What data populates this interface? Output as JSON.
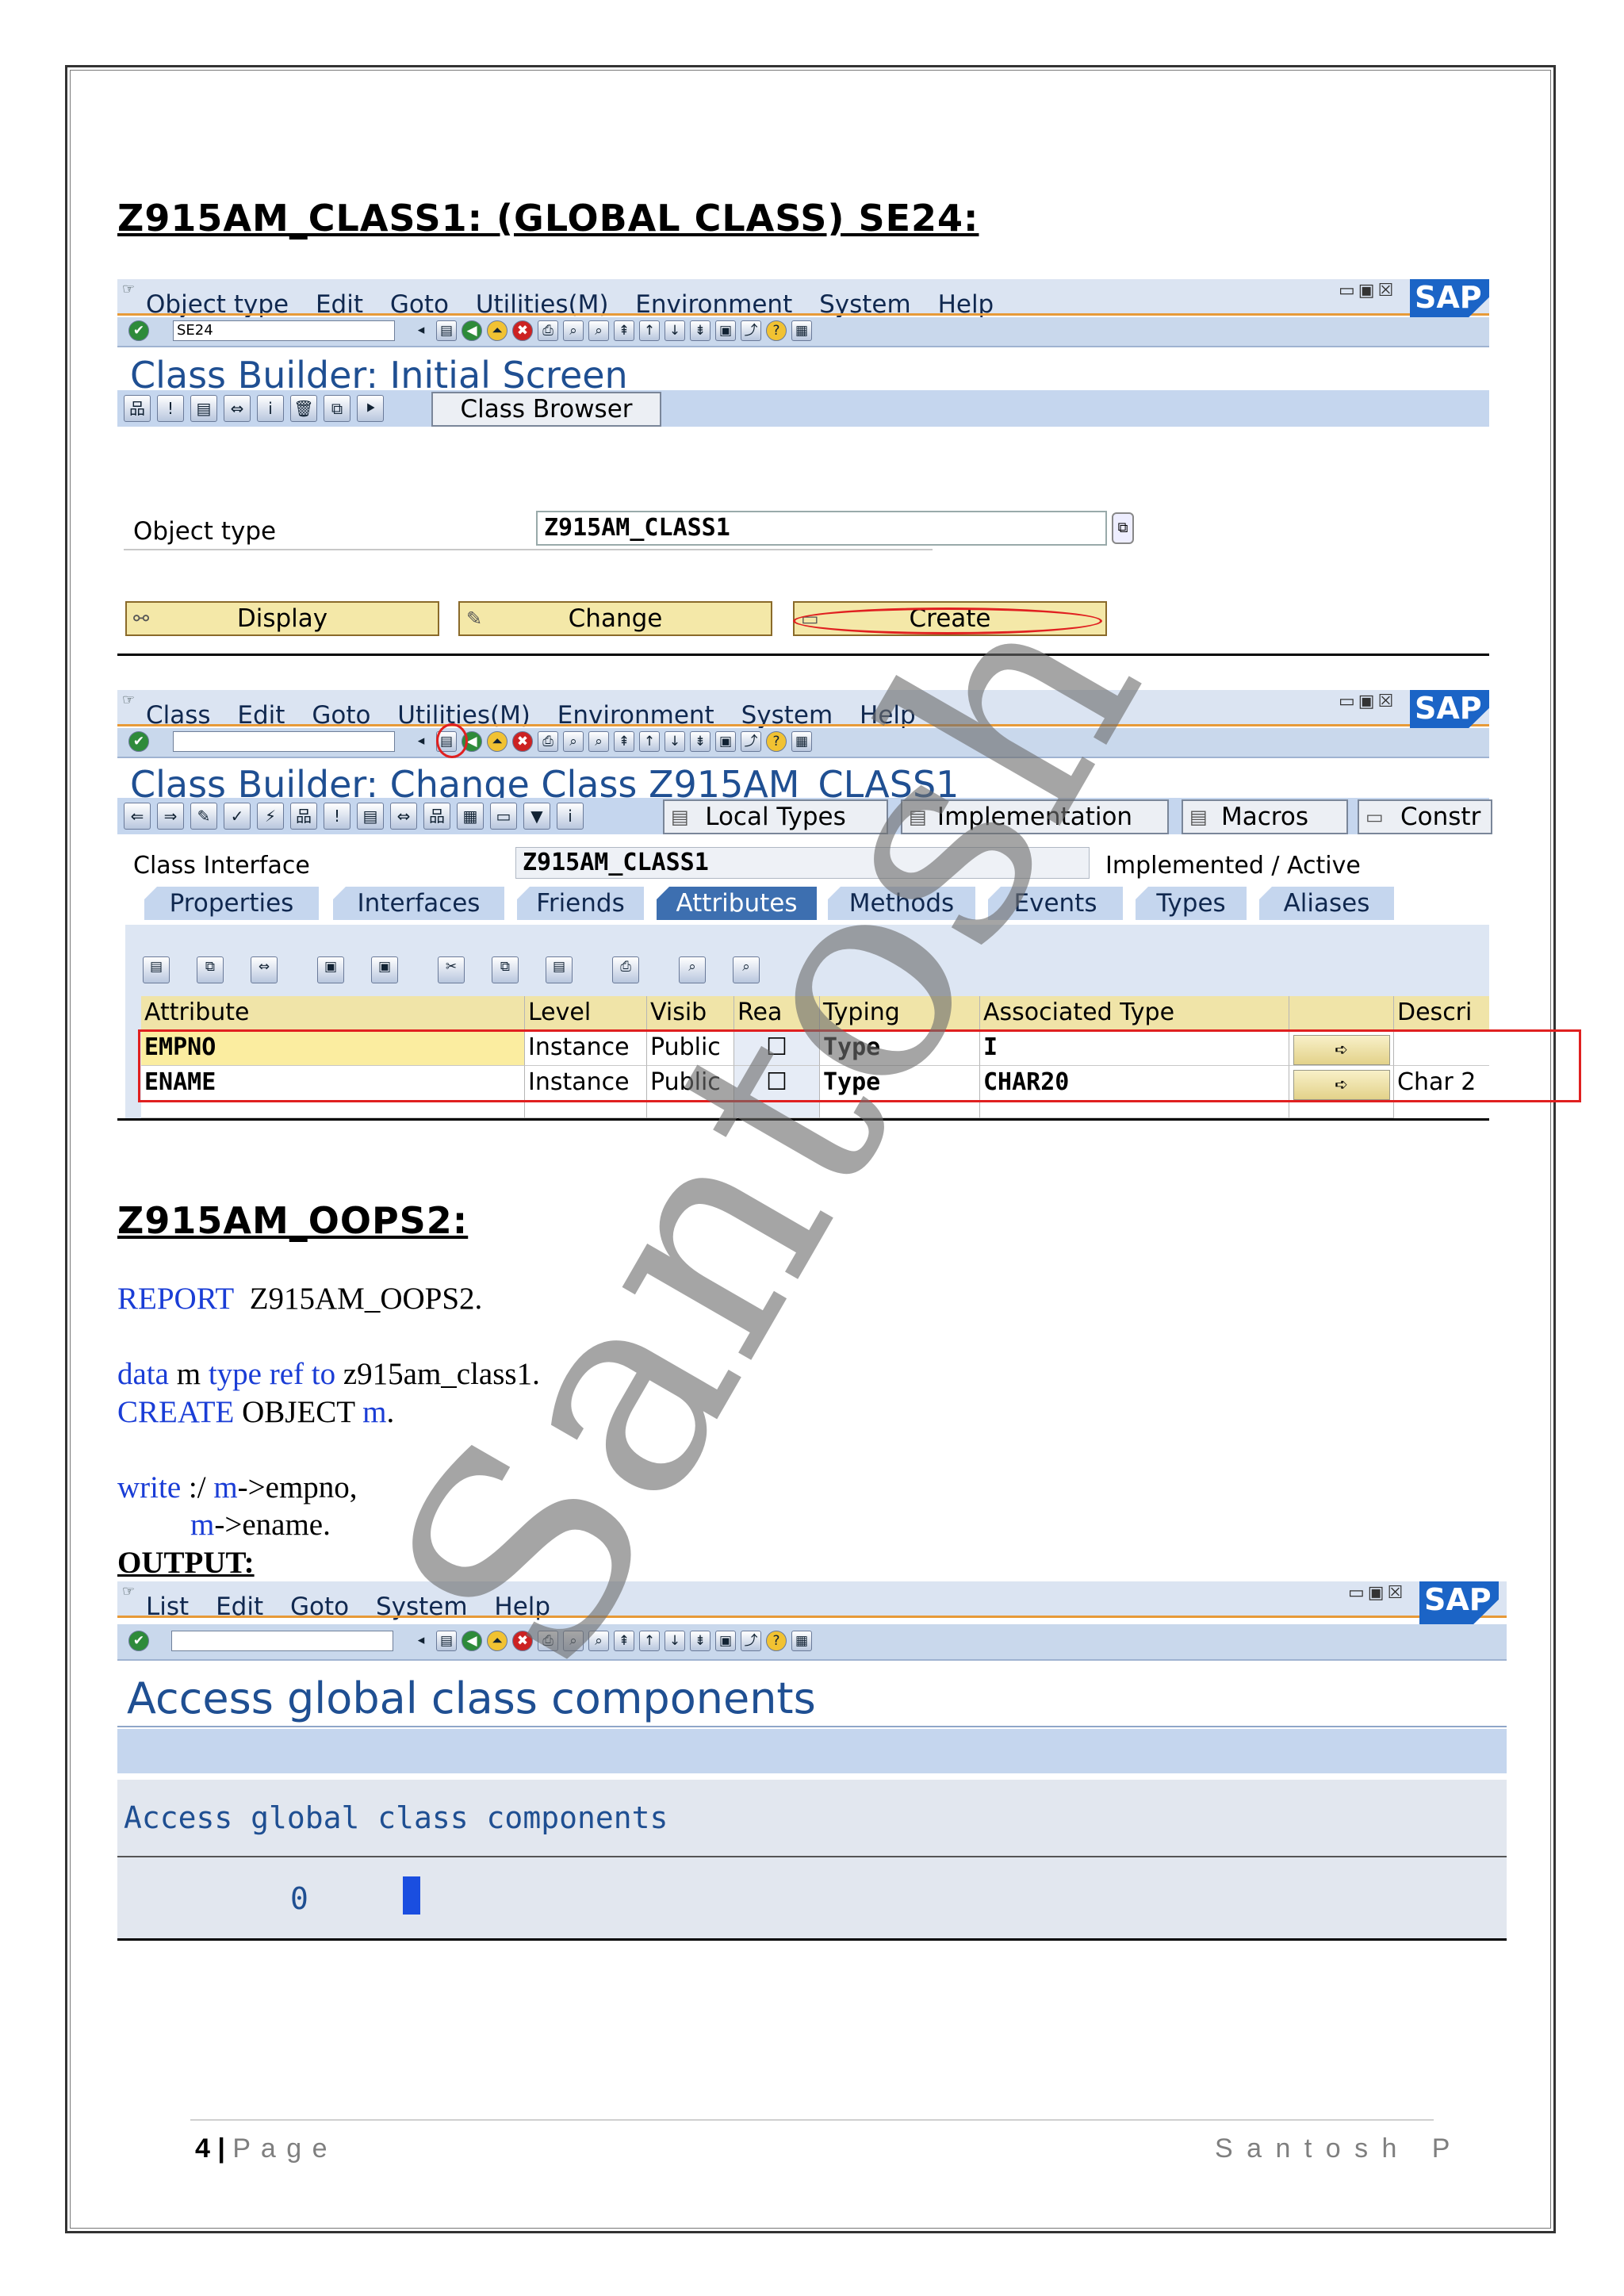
{
  "heading1": "Z915AM_CLASS1: (GLOBAL CLASS) SE24:",
  "heading2": "Z915AM_OOPS2:",
  "sap1": {
    "menu": [
      "Object type",
      "Edit",
      "Goto",
      "Utilities(M)",
      "Environment",
      "System",
      "Help"
    ],
    "command": "SE24",
    "title": "Class Builder: Initial Screen",
    "class_browser": "Class Browser",
    "object_type_label": "Object type",
    "object_type_value": "Z915AM_CLASS1",
    "display": "Display",
    "change": "Change",
    "create": "Create"
  },
  "sap2": {
    "menu": [
      "Class",
      "Edit",
      "Goto",
      "Utilities(M)",
      "Environment",
      "System",
      "Help"
    ],
    "title": "Class Builder: Change Class Z915AM_CLASS1",
    "toolbar_buttons": [
      "Local Types",
      "Implementation",
      "Macros",
      "Constr"
    ],
    "class_interface_label": "Class Interface",
    "class_interface_value": "Z915AM_CLASS1",
    "status": "Implemented / Active",
    "tabs": [
      "Properties",
      "Interfaces",
      "Friends",
      "Attributes",
      "Methods",
      "Events",
      "Types",
      "Aliases"
    ],
    "columns": [
      "Attribute",
      "Level",
      "Visib",
      "Rea",
      "Typing",
      "Associated Type",
      "",
      "Descri"
    ],
    "rows": [
      {
        "attribute": "EMPNO",
        "level": "Instance",
        "visib": "Public",
        "typing": "Type",
        "assoc": "I",
        "descr": ""
      },
      {
        "attribute": "ENAME",
        "level": "Instance",
        "visib": "Public",
        "typing": "Type",
        "assoc": "CHAR20",
        "descr": "Char 2"
      }
    ]
  },
  "code": {
    "line1": {
      "kw": "REPORT",
      "text": "Z915AM_OOPS2."
    },
    "line2": {
      "kw1": "data",
      "t1": "m",
      "kw2": "type ref to",
      "t2": "z915am_class1."
    },
    "line3": {
      "kw": "CREATE",
      "t1": "OBJECT",
      "kw2": "m",
      "t2": "."
    },
    "line4": {
      "kw": "write",
      "t1": ":/",
      "kw2": "m",
      "t2": "->empno,"
    },
    "line5": {
      "kw": "m",
      "t": "->ename."
    },
    "output_label": "OUTPUT:"
  },
  "sap3": {
    "menu": [
      "List",
      "Edit",
      "Goto",
      "System",
      "Help"
    ],
    "title": "Access global class components",
    "list_header": "Access global class components",
    "value": "0"
  },
  "sap_logo": "SAP",
  "footer": {
    "page_num": "4",
    "page_word": "P a g e",
    "author": "S a n t o s h   P"
  },
  "watermark": "Santosh"
}
